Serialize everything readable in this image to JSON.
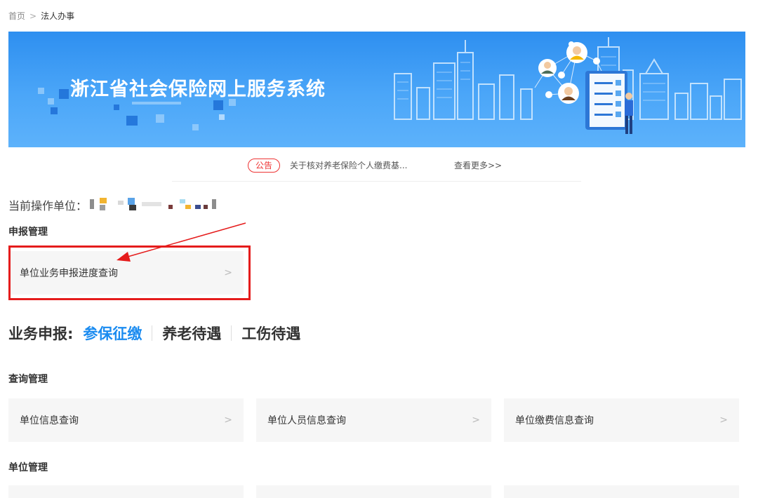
{
  "breadcrumb": {
    "home": "首页",
    "separator": ">",
    "current": "法人办事"
  },
  "banner": {
    "title": "浙江省社会保险网上服务系统"
  },
  "notice": {
    "badge": "公告",
    "text": "关于核对养老保险个人缴费基...",
    "more": "查看更多>>"
  },
  "unit": {
    "label": "当前操作单位："
  },
  "declare": {
    "title": "申报管理",
    "items": [
      {
        "label": "单位业务申报进度查询",
        "chevron": ">"
      }
    ]
  },
  "business": {
    "label": "业务申报:",
    "tabs": [
      {
        "label": "参保征缴",
        "active": true
      },
      {
        "label": "养老待遇"
      },
      {
        "label": "工伤待遇"
      }
    ]
  },
  "query": {
    "title": "查询管理",
    "items": [
      {
        "label": "单位信息查询",
        "chevron": ">"
      },
      {
        "label": "单位人员信息查询",
        "chevron": ">"
      },
      {
        "label": "单位缴费信息查询",
        "chevron": ">"
      }
    ]
  },
  "unit_mgmt": {
    "title": "单位管理"
  },
  "colors": {
    "accent": "#1a8bf0",
    "banner": "#3d9cf5",
    "annotation": "#e51c1c"
  }
}
